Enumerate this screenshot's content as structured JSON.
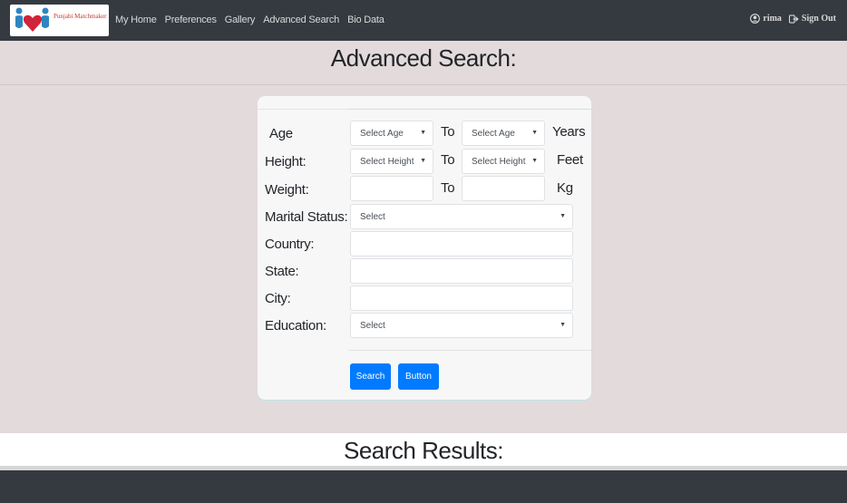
{
  "navbar": {
    "logo_text": "Punjabi Matchmaker",
    "links": [
      "My Home",
      "Preferences",
      "Gallery",
      "Advanced Search",
      "Bio Data"
    ],
    "user_name": "rima",
    "signout_label": "Sign Out"
  },
  "page_title": "Advanced Search:",
  "form": {
    "age": {
      "label": "Age",
      "from_placeholder": "Select Age",
      "to_label": "To",
      "to_placeholder": "Select Age",
      "unit": "Years"
    },
    "height": {
      "label": "Height:",
      "from_placeholder": "Select Height",
      "to_label": "To",
      "to_placeholder": "Select Height",
      "unit": "Feet"
    },
    "weight": {
      "label": "Weight:",
      "from_value": "",
      "to_label": "To",
      "to_value": "",
      "unit": "Kg"
    },
    "marital_status": {
      "label": "Marital Status:",
      "value": "Select"
    },
    "country": {
      "label": "Country:",
      "value": ""
    },
    "state": {
      "label": "State:",
      "value": ""
    },
    "city": {
      "label": "City:",
      "value": ""
    },
    "education": {
      "label": "Education:",
      "value": "Select"
    },
    "search_button": "Search",
    "other_button": "Button"
  },
  "results_title": "Search Results:",
  "colors": {
    "navbar": "#343a40",
    "page_bg": "#e3dadb",
    "primary": "#007bff"
  }
}
